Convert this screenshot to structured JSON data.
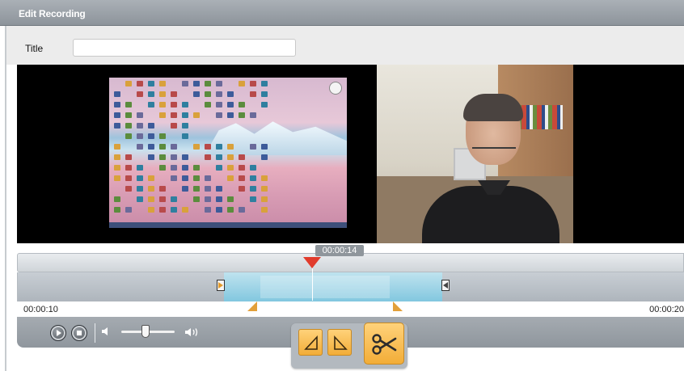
{
  "window": {
    "title": "Edit Recording"
  },
  "form": {
    "title_label": "Title",
    "title_value": "",
    "title_placeholder": ""
  },
  "timeline": {
    "playhead_time": "00:00:14",
    "range_start": "00:00:10",
    "range_end": "00:00:20"
  },
  "playback": {
    "play_icon": "play-icon",
    "stop_icon": "stop-icon",
    "volume_low_icon": "speaker-low-icon",
    "volume_high_icon": "speaker-high-icon",
    "volume_level": 0.45
  },
  "edit_tools": {
    "trim_in_icon": "trim-in-icon",
    "trim_out_icon": "trim-out-icon",
    "cut_icon": "scissors-icon"
  },
  "colors": {
    "accent": "#f2ad38",
    "playhead": "#e13b2c",
    "selection": "#82c7df"
  }
}
